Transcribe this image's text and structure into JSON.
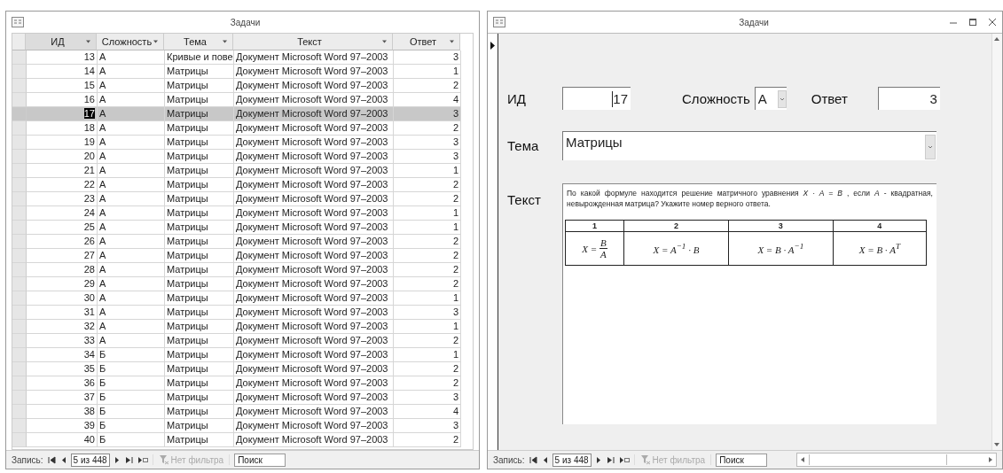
{
  "datasheet": {
    "title": "Задачи",
    "columns": [
      {
        "label": "ИД"
      },
      {
        "label": "Сложность"
      },
      {
        "label": "Тема"
      },
      {
        "label": "Текст"
      },
      {
        "label": "Ответ"
      }
    ],
    "rows": [
      {
        "id": "13",
        "level": "А",
        "topic": "Кривые и пове",
        "text": "Документ Microsoft Word 97–2003",
        "answer": "3",
        "selected": false
      },
      {
        "id": "14",
        "level": "А",
        "topic": "Матрицы",
        "text": "Документ Microsoft Word 97–2003",
        "answer": "1",
        "selected": false
      },
      {
        "id": "15",
        "level": "А",
        "topic": "Матрицы",
        "text": "Документ Microsoft Word 97–2003",
        "answer": "2",
        "selected": false
      },
      {
        "id": "16",
        "level": "А",
        "topic": "Матрицы",
        "text": "Документ Microsoft Word 97–2003",
        "answer": "4",
        "selected": false
      },
      {
        "id": "17",
        "level": "А",
        "topic": "Матрицы",
        "text": "Документ Microsoft Word 97–2003",
        "answer": "3",
        "selected": true
      },
      {
        "id": "18",
        "level": "А",
        "topic": "Матрицы",
        "text": "Документ Microsoft Word 97–2003",
        "answer": "2",
        "selected": false
      },
      {
        "id": "19",
        "level": "А",
        "topic": "Матрицы",
        "text": "Документ Microsoft Word 97–2003",
        "answer": "3",
        "selected": false
      },
      {
        "id": "20",
        "level": "А",
        "topic": "Матрицы",
        "text": "Документ Microsoft Word 97–2003",
        "answer": "3",
        "selected": false
      },
      {
        "id": "21",
        "level": "А",
        "topic": "Матрицы",
        "text": "Документ Microsoft Word 97–2003",
        "answer": "1",
        "selected": false
      },
      {
        "id": "22",
        "level": "А",
        "topic": "Матрицы",
        "text": "Документ Microsoft Word 97–2003",
        "answer": "2",
        "selected": false
      },
      {
        "id": "23",
        "level": "А",
        "topic": "Матрицы",
        "text": "Документ Microsoft Word 97–2003",
        "answer": "2",
        "selected": false
      },
      {
        "id": "24",
        "level": "А",
        "topic": "Матрицы",
        "text": "Документ Microsoft Word 97–2003",
        "answer": "1",
        "selected": false
      },
      {
        "id": "25",
        "level": "А",
        "topic": "Матрицы",
        "text": "Документ Microsoft Word 97–2003",
        "answer": "1",
        "selected": false
      },
      {
        "id": "26",
        "level": "А",
        "topic": "Матрицы",
        "text": "Документ Microsoft Word 97–2003",
        "answer": "2",
        "selected": false
      },
      {
        "id": "27",
        "level": "А",
        "topic": "Матрицы",
        "text": "Документ Microsoft Word 97–2003",
        "answer": "2",
        "selected": false
      },
      {
        "id": "28",
        "level": "А",
        "topic": "Матрицы",
        "text": "Документ Microsoft Word 97–2003",
        "answer": "2",
        "selected": false
      },
      {
        "id": "29",
        "level": "А",
        "topic": "Матрицы",
        "text": "Документ Microsoft Word 97–2003",
        "answer": "2",
        "selected": false
      },
      {
        "id": "30",
        "level": "А",
        "topic": "Матрицы",
        "text": "Документ Microsoft Word 97–2003",
        "answer": "1",
        "selected": false
      },
      {
        "id": "31",
        "level": "А",
        "topic": "Матрицы",
        "text": "Документ Microsoft Word 97–2003",
        "answer": "3",
        "selected": false
      },
      {
        "id": "32",
        "level": "А",
        "topic": "Матрицы",
        "text": "Документ Microsoft Word 97–2003",
        "answer": "1",
        "selected": false
      },
      {
        "id": "33",
        "level": "А",
        "topic": "Матрицы",
        "text": "Документ Microsoft Word 97–2003",
        "answer": "2",
        "selected": false
      },
      {
        "id": "34",
        "level": "Б",
        "topic": "Матрицы",
        "text": "Документ Microsoft Word 97–2003",
        "answer": "1",
        "selected": false
      },
      {
        "id": "35",
        "level": "Б",
        "topic": "Матрицы",
        "text": "Документ Microsoft Word 97–2003",
        "answer": "2",
        "selected": false
      },
      {
        "id": "36",
        "level": "Б",
        "topic": "Матрицы",
        "text": "Документ Microsoft Word 97–2003",
        "answer": "2",
        "selected": false
      },
      {
        "id": "37",
        "level": "Б",
        "topic": "Матрицы",
        "text": "Документ Microsoft Word 97–2003",
        "answer": "3",
        "selected": false
      },
      {
        "id": "38",
        "level": "Б",
        "topic": "Матрицы",
        "text": "Документ Microsoft Word 97–2003",
        "answer": "4",
        "selected": false
      },
      {
        "id": "39",
        "level": "Б",
        "topic": "Матрицы",
        "text": "Документ Microsoft Word 97–2003",
        "answer": "3",
        "selected": false
      },
      {
        "id": "40",
        "level": "Б",
        "topic": "Матрицы",
        "text": "Документ Microsoft Word 97–2003",
        "answer": "2",
        "selected": false
      }
    ],
    "nav": {
      "label": "Запись:",
      "position": "5 из 448",
      "filter": "Нет фильтра",
      "filter_disabled": true,
      "search": "Поиск"
    }
  },
  "form": {
    "title": "Задачи",
    "id_label": "ИД",
    "id_value": "17",
    "level_label": "Сложность",
    "level_value": "А",
    "answer_label": "Ответ",
    "answer_value": "3",
    "topic_label": "Тема",
    "topic_value": "Матрицы",
    "text_label": "Текст",
    "question": "По какой формуле находится решение матричного уравнения *X · A = B* , если *A* - квадратная, невырожденная матрица? Укажите номер верного ответа.",
    "options": [
      {
        "header": "1",
        "kind": "fraction",
        "lhs": "X =",
        "numerator": "B",
        "denominator": "A"
      },
      {
        "header": "2",
        "kind": "inline",
        "formula": "X = A$^{−1}$ · B"
      },
      {
        "header": "3",
        "kind": "inline",
        "formula": "X = B · A$^{−1}$"
      },
      {
        "header": "4",
        "kind": "inline",
        "formula": "X = B · A$^{T}$"
      }
    ],
    "nav": {
      "label": "Запись:",
      "position": "5 из 448",
      "filter": "Нет фильтра",
      "filter_disabled": true,
      "search": "Поиск"
    }
  }
}
